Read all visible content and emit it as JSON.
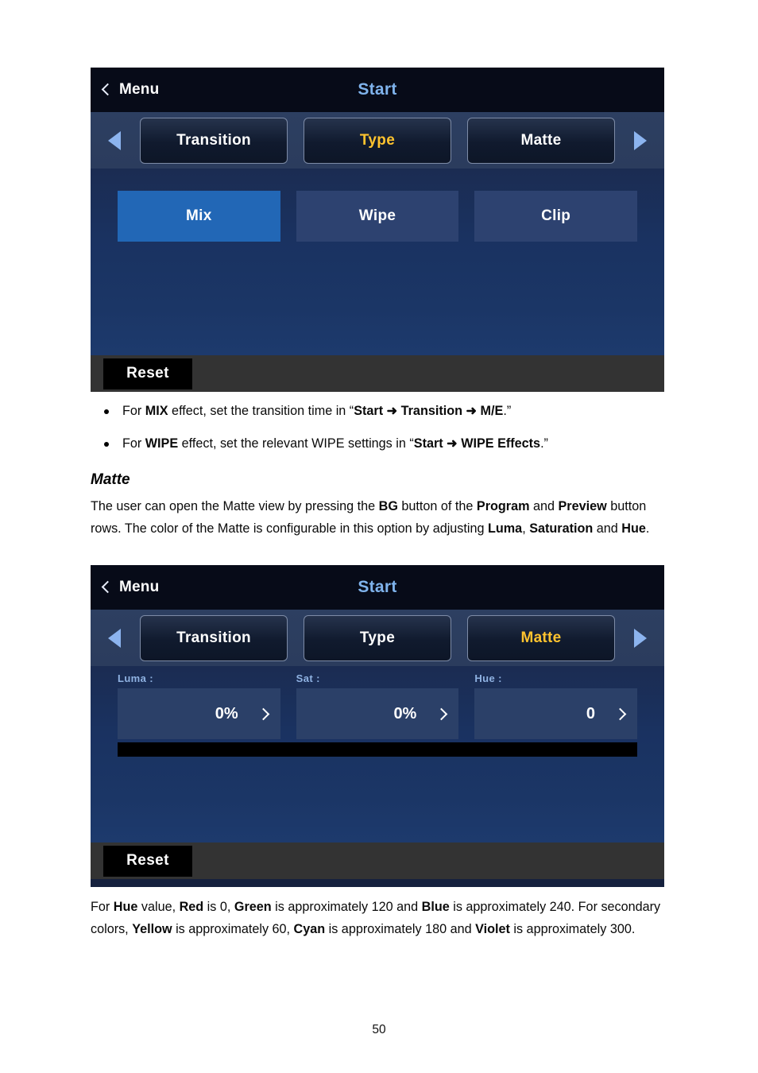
{
  "document": {
    "page_number": "50"
  },
  "panel_type": {
    "header": {
      "back_label": "Menu",
      "title": "Start",
      "back_icon": "chevron-left-icon"
    },
    "nav": {
      "prev_icon": "triangle-left-icon",
      "next_icon": "triangle-right-icon"
    },
    "tabs": [
      {
        "label": "Transition",
        "active": false
      },
      {
        "label": "Type",
        "active": true
      },
      {
        "label": "Matte",
        "active": false
      }
    ],
    "options": [
      {
        "label": "Mix",
        "selected": true
      },
      {
        "label": "Wipe",
        "selected": false
      },
      {
        "label": "Clip",
        "selected": false
      }
    ],
    "footer": {
      "reset_label": "Reset"
    }
  },
  "panel_matte": {
    "header": {
      "back_label": "Menu",
      "title": "Start",
      "back_icon": "chevron-left-icon"
    },
    "nav": {
      "prev_icon": "triangle-left-icon",
      "next_icon": "triangle-right-icon"
    },
    "tabs": [
      {
        "label": "Transition",
        "active": false
      },
      {
        "label": "Type",
        "active": false
      },
      {
        "label": "Matte",
        "active": true
      }
    ],
    "params": [
      {
        "label": "Luma :",
        "value": "0%",
        "stepper_icon": "chevron-right-icon"
      },
      {
        "label": "Sat :",
        "value": "0%",
        "stepper_icon": "chevron-right-icon"
      },
      {
        "label": "Hue :",
        "value": "0",
        "stepper_icon": "chevron-right-icon"
      }
    ],
    "color_preview": "#000000",
    "footer": {
      "reset_label": "Reset"
    }
  },
  "bullets": [
    "For <b>MIX</b> effect, set the transition time in “<b>Start ➜ Transition ➜ M/E</b>.”",
    "For <b>WIPE</b> effect, set the relevant WIPE settings in “<b>Start ➜ WIPE Effects</b>.”"
  ],
  "matte_section": {
    "heading": "Matte",
    "body": "The user can open the Matte view by pressing the <b>BG</b> button of the <b>Program</b> and <b>Preview</b> button rows. The color of the Matte is configurable in this option by adjusting <b>Luma</b>, <b>Saturation</b> and <b>Hue</b>."
  },
  "hue_note": {
    "body": "For <b>Hue</b> value, <b>Red</b> is 0, <b>Green</b> is approximately 120 and <b>Blue</b> is approximately 240. For secondary colors, <b>Yellow</b> is approximately 60, <b>Cyan</b> is approximately 180 and <b>Violet</b> is approximately 300."
  },
  "theme": {
    "accent_active_tab": "#ffc32e",
    "title_blue": "#7fb3ec",
    "selected_option_blue": "#2267b6",
    "option_blue": "#2d4270",
    "panel_blue": "#1a3261",
    "header_black": "#070b18",
    "footer_gray": "#333333"
  }
}
